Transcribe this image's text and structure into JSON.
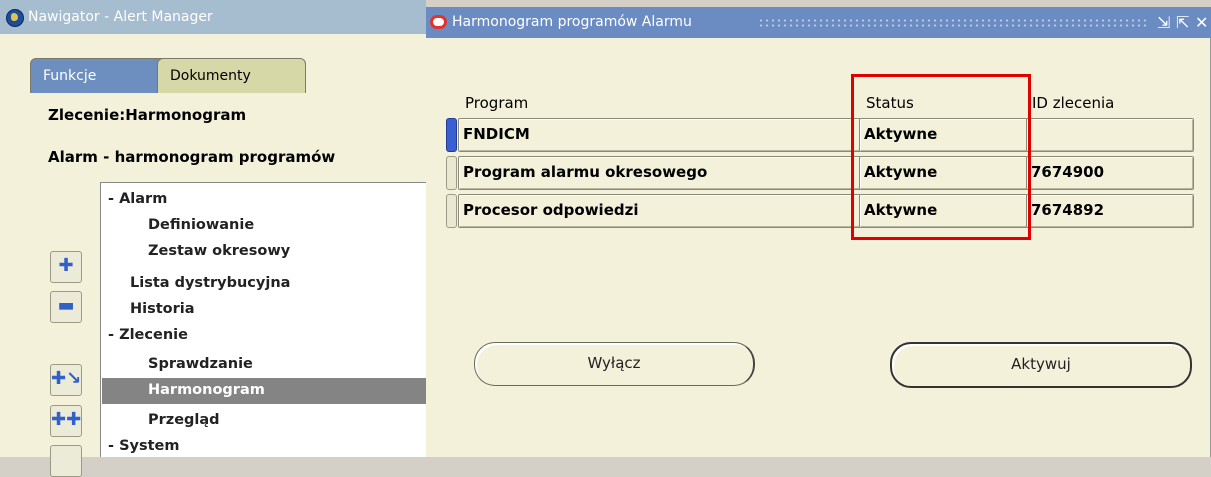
{
  "navigator": {
    "title": "Nawigator - Alert Manager",
    "tabs": [
      {
        "label": "Funkcje",
        "active": true
      },
      {
        "label": "Dokumenty",
        "active": false
      }
    ],
    "label1": "Zlecenie:Harmonogram",
    "label2": "Alarm - harmonogram programów",
    "tree": [
      {
        "prefix": "- ",
        "label": "Alarm"
      },
      {
        "label": "Definiowanie"
      },
      {
        "label": "Zestaw okresowy"
      },
      {
        "label": "Lista dystrybucyjna"
      },
      {
        "label": "Historia"
      },
      {
        "prefix": "- ",
        "label": "Zlecenie"
      },
      {
        "label": "Sprawdzanie"
      },
      {
        "label": "Harmonogram",
        "selected": true
      },
      {
        "label": "Przegląd"
      },
      {
        "prefix": "- ",
        "label": "System"
      }
    ],
    "side_buttons": [
      "expand-icon",
      "collapse-icon",
      "expand-branch-icon",
      "expand-all-icon"
    ]
  },
  "dialog": {
    "title": "Harmonogram programów Alarmu",
    "controls": [
      "minimize-icon",
      "maximize-icon",
      "close-icon"
    ],
    "columns": [
      "Program",
      "Status",
      "ID zlecenia"
    ],
    "rows": [
      {
        "program": "FNDICM",
        "status": "Aktywne",
        "id": ""
      },
      {
        "program": "Program alarmu okresowego",
        "status": "Aktywne",
        "id": "7674900"
      },
      {
        "program": "Procesor odpowiedzi",
        "status": "Aktywne",
        "id": "7674892"
      }
    ],
    "buttons": {
      "deactivate": "Wyłącz",
      "activate": "Aktywuj"
    }
  },
  "colors": {
    "highlight": "#e00000",
    "tab_active": "#6c8fbf",
    "selection": "#848484"
  }
}
